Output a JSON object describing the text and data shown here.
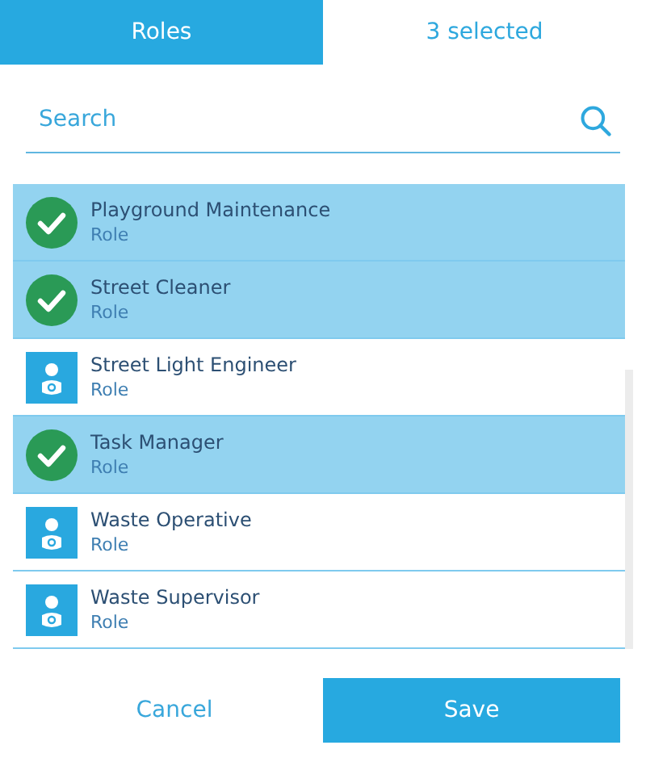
{
  "tabs": [
    {
      "label": "Roles",
      "selected": true
    },
    {
      "label": "3 selected",
      "selected": false
    }
  ],
  "search": {
    "placeholder": "Search"
  },
  "roles": [
    {
      "name": "Playground Maintenance",
      "type": "Role",
      "selected": true
    },
    {
      "name": "Street Cleaner",
      "type": "Role",
      "selected": true
    },
    {
      "name": "Street Light Engineer",
      "type": "Role",
      "selected": false
    },
    {
      "name": "Task Manager",
      "type": "Role",
      "selected": true
    },
    {
      "name": "Waste Operative",
      "type": "Role",
      "selected": false
    },
    {
      "name": "Waste Supervisor",
      "type": "Role",
      "selected": false
    }
  ],
  "buttons": [
    {
      "label": "Cancel",
      "kind": "secondary"
    },
    {
      "label": "Save",
      "kind": "primary"
    }
  ]
}
